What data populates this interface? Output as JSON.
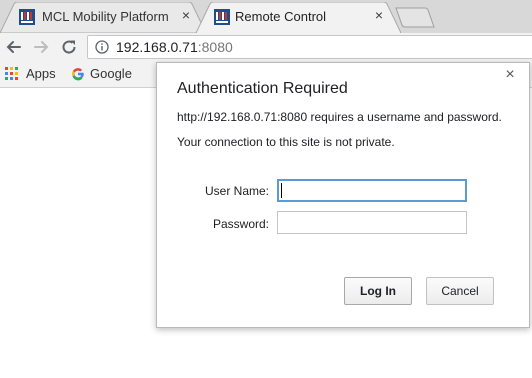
{
  "browser": {
    "tabs": [
      {
        "title": "MCL Mobility Platform -",
        "icon": "mcl-logo-icon",
        "active": false
      },
      {
        "title": "Remote Control",
        "icon": "mcl-logo-icon",
        "active": true
      }
    ],
    "tab_close_glyph": "×",
    "address": {
      "host": "192.168.0.71",
      "port": ":8080"
    },
    "bookmarks": [
      {
        "label": "Apps",
        "icon": "apps-grid-icon"
      },
      {
        "label": "Google",
        "icon": "google-g-icon"
      }
    ]
  },
  "dialog": {
    "title": "Authentication Required",
    "message": "http://192.168.0.71:8080 requires a username and password.",
    "privacy_note": "Your connection to this site is not private.",
    "username_label": "User Name:",
    "username_value": "",
    "password_label": "Password:",
    "password_value": "",
    "login_label": "Log In",
    "cancel_label": "Cancel",
    "close_glyph": "×"
  },
  "colors": {
    "tabstrip": "#d8d8d8",
    "toolbar": "#f2f2f2",
    "focus_ring": "#5b9bd5",
    "mcl_logo_blue": "#1f4e8c",
    "mcl_logo_red": "#c0392b"
  }
}
